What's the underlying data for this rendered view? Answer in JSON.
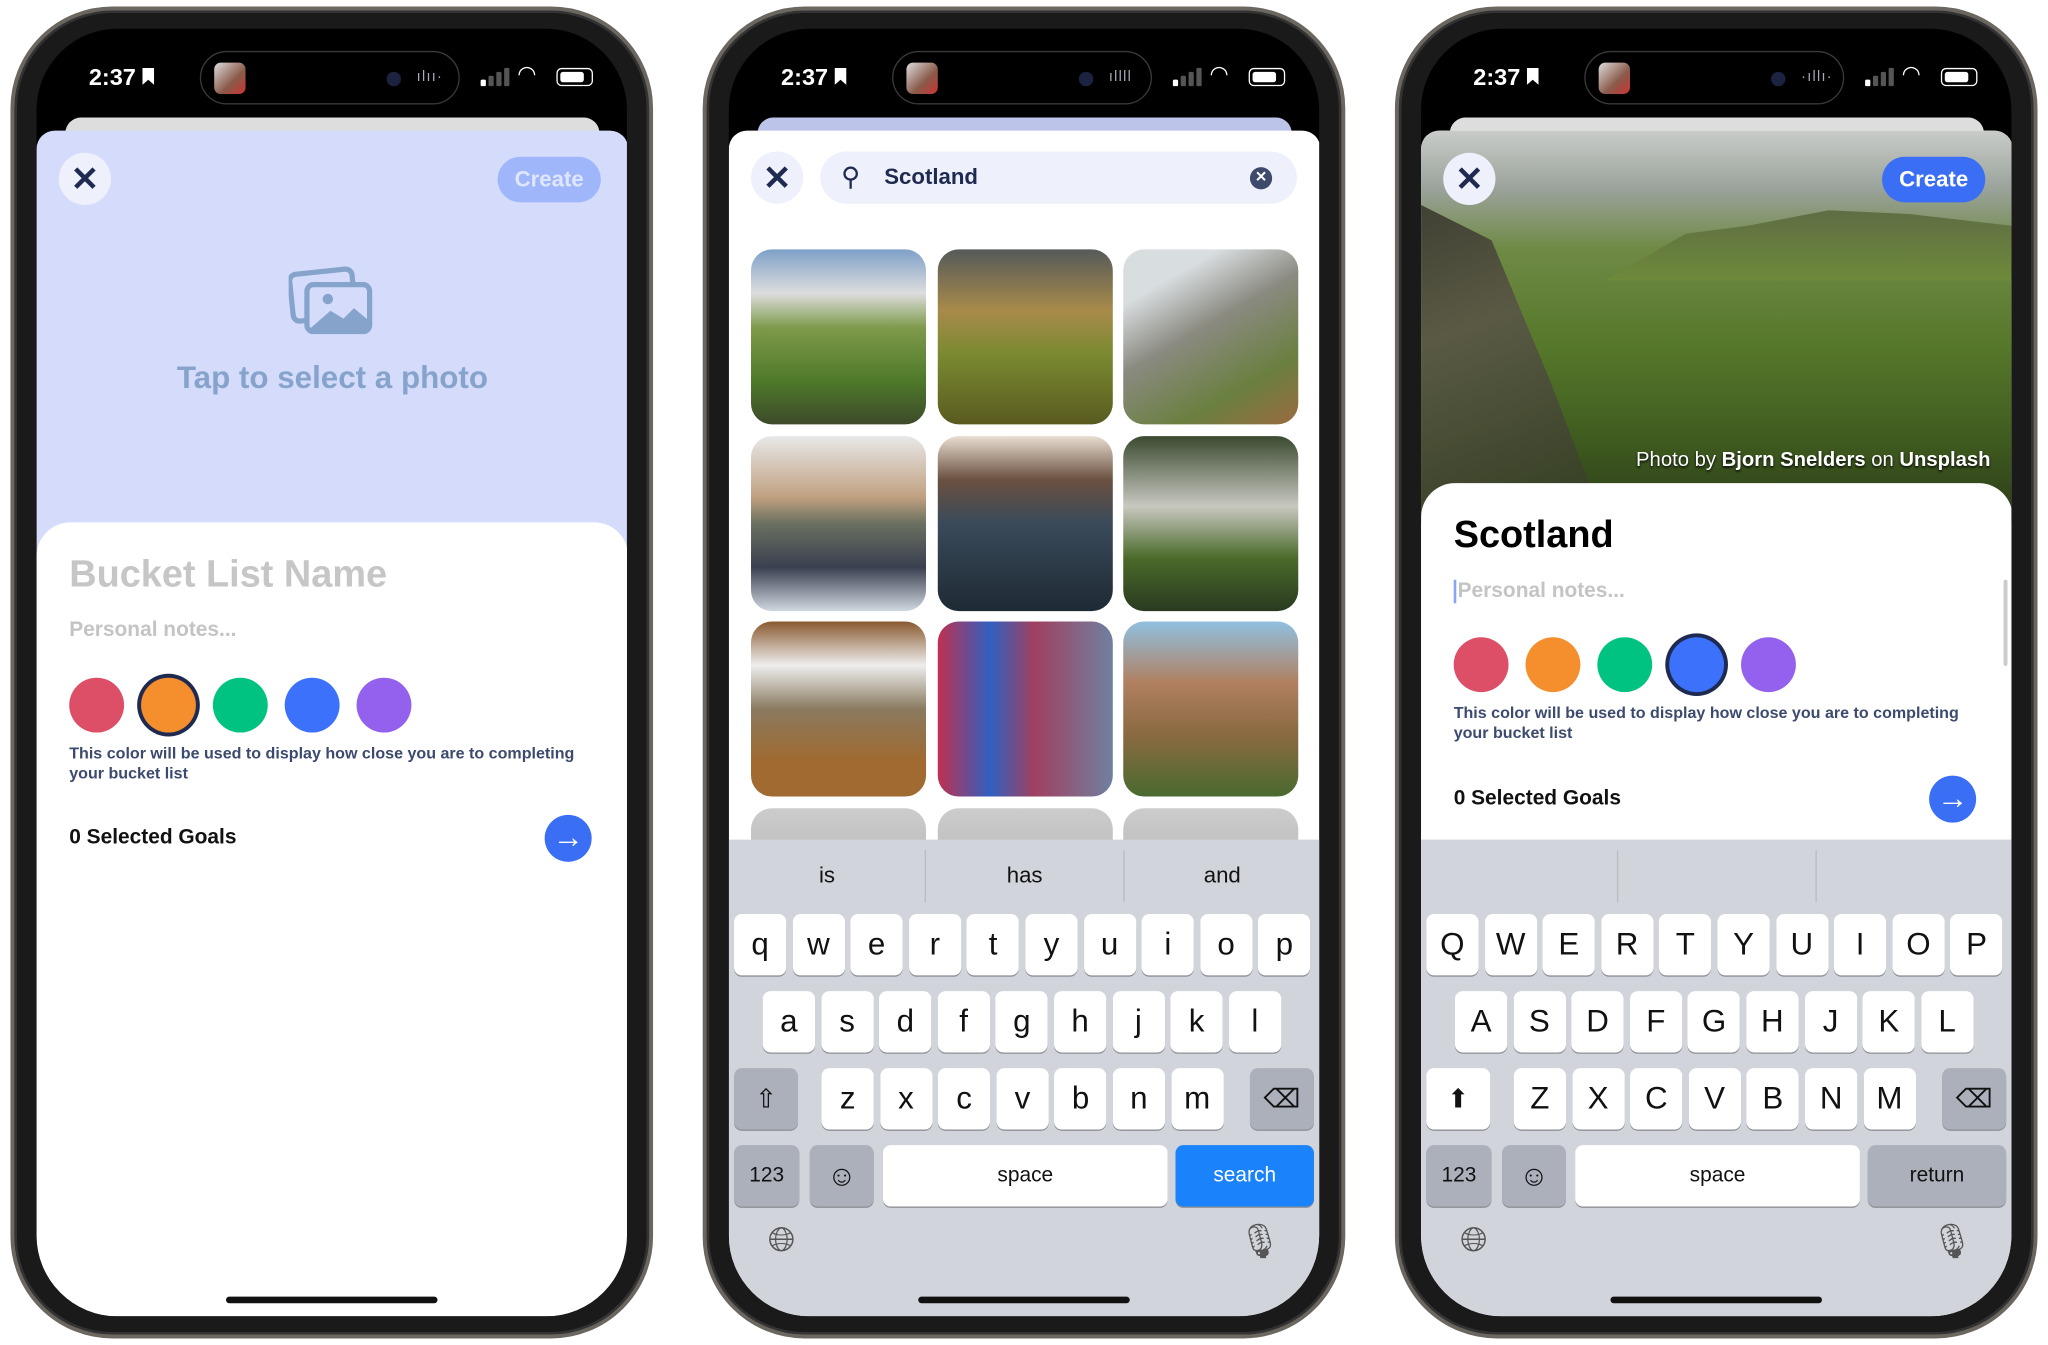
{
  "status_bar": {
    "time": "2:37"
  },
  "colors": {
    "red": "#dd4f67",
    "orange": "#f58e2c",
    "green": "#00c281",
    "blue": "#3b71fb",
    "purple": "#9460ee",
    "accent": "#3a6ef5",
    "selected_ring": "#1e2a4f",
    "keyboard_search": "#1a82fb"
  },
  "screen1": {
    "create_label": "Create",
    "photo_prompt": "Tap to select a photo",
    "photo_icon": "photo-stack-icon",
    "name_placeholder": "Bucket List Name",
    "notes_placeholder": "Personal notes...",
    "selected_color": "orange",
    "color_hint": "This color will be used to display how close you are to completing your bucket list",
    "goals_label": "0 Selected Goals"
  },
  "screen2": {
    "search_value": "Scotland",
    "photos": [
      "Quiraing hills",
      "Golden hour ridge",
      "Highland cow",
      "Kilchurn castle lake",
      "Sea cliffs lighthouse",
      "Glenfinnan viaduct",
      "Steam train viaduct",
      "Victoria Street",
      "Dean Village"
    ],
    "suggestions": [
      "is",
      "has",
      "and"
    ],
    "keyboard": {
      "rows": [
        [
          "q",
          "w",
          "e",
          "r",
          "t",
          "y",
          "u",
          "i",
          "o",
          "p"
        ],
        [
          "a",
          "s",
          "d",
          "f",
          "g",
          "h",
          "j",
          "k",
          "l"
        ],
        [
          "z",
          "x",
          "c",
          "v",
          "b",
          "n",
          "m"
        ]
      ],
      "numbers": "123",
      "space": "space",
      "action": "search"
    }
  },
  "screen3": {
    "create_label": "Create",
    "credit_prefix": "Photo by ",
    "credit_author": "Bjorn Snelders",
    "credit_mid": " on ",
    "credit_site": "Unsplash",
    "title": "Scotland",
    "notes_placeholder": "Personal notes...",
    "selected_color": "blue",
    "color_hint": "This color will be used to display how close you are to completing your bucket list",
    "goals_label": "0 Selected Goals",
    "suggestions": [
      "",
      "",
      ""
    ],
    "keyboard": {
      "rows": [
        [
          "Q",
          "W",
          "E",
          "R",
          "T",
          "Y",
          "U",
          "I",
          "O",
          "P"
        ],
        [
          "A",
          "S",
          "D",
          "F",
          "G",
          "H",
          "J",
          "K",
          "L"
        ],
        [
          "Z",
          "X",
          "C",
          "V",
          "B",
          "N",
          "M"
        ]
      ],
      "numbers": "123",
      "space": "space",
      "action": "return"
    }
  }
}
